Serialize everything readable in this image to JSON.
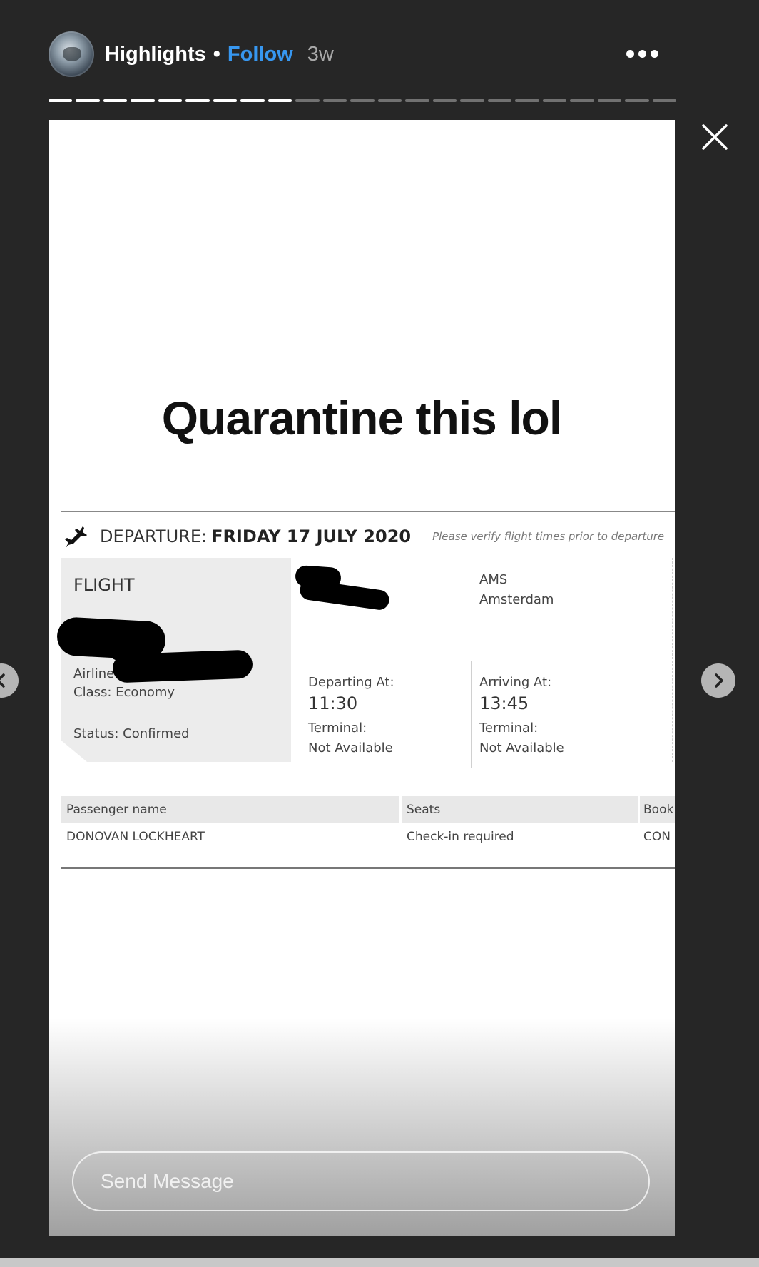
{
  "header": {
    "username": "Highlights",
    "separator": "•",
    "follow_label": "Follow",
    "age": "3w",
    "more_icon": "more-horizontal-icon",
    "close_icon": "close-icon"
  },
  "progress": {
    "total_segments": 23,
    "completed_segments": 9
  },
  "story": {
    "caption": "Quarantine this lol",
    "ticket": {
      "departure_label": "DEPARTURE:",
      "departure_date": "FRIDAY 17 JULY 2020",
      "verify_note": "Please verify flight times prior to departure",
      "flight_label": "FLIGHT",
      "airline_label": "Airline",
      "class_label": "Class: Economy",
      "status_label": "Status: Confirmed",
      "arrival_code": "AMS",
      "arrival_city": "Amsterdam",
      "departing_label": "Departing At:",
      "departing_time": "11:30",
      "departing_terminal_label": "Terminal:",
      "departing_terminal_value": "Not Available",
      "arriving_label": "Arriving At:",
      "arriving_time": "13:45",
      "arriving_terminal_label": "Terminal:",
      "arriving_terminal_value": "Not Available",
      "passenger_table": {
        "headers": [
          "Passenger name",
          "Seats",
          "Book"
        ],
        "rows": [
          [
            "DONOVAN LOCKHEART",
            "Check-in required",
            "CON"
          ]
        ]
      }
    }
  },
  "message": {
    "placeholder": "Send Message"
  },
  "nav": {
    "prev_icon": "chevron-left-icon",
    "next_icon": "chevron-right-icon"
  },
  "colors": {
    "background": "#262626",
    "follow": "#3797f0",
    "story_bg": "#ffffff"
  }
}
